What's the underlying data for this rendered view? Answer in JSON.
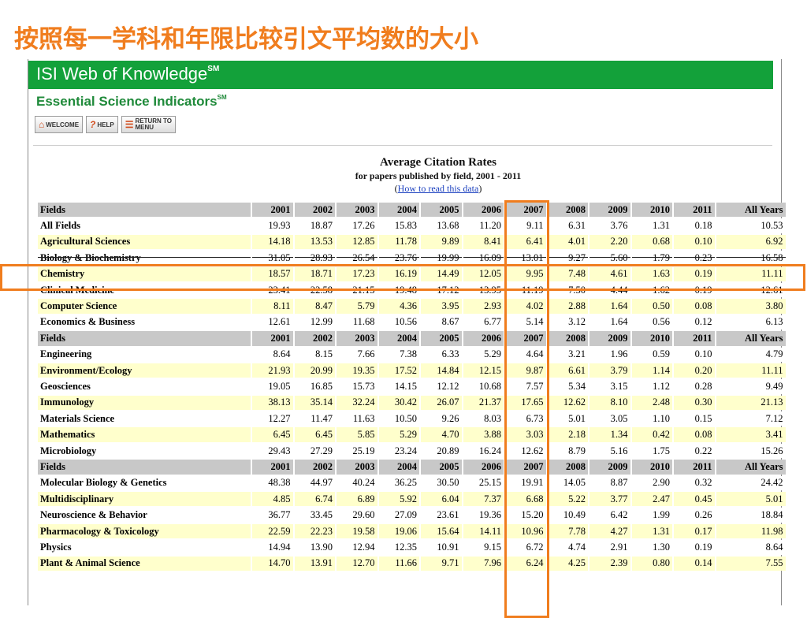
{
  "slide_title": "按照每一学科和年限比较引文平均数的大小",
  "app": {
    "brand": "ISI Web of Knowledge",
    "brand_mark": "SM",
    "product": "Essential Science Indicators",
    "product_mark": "SM"
  },
  "toolbar": {
    "welcome": "WELCOME",
    "help": "HELP",
    "return_line1": "RETURN TO",
    "return_line2": "MENU"
  },
  "heading": {
    "title": "Average Citation Rates",
    "subtitle": "for papers published by field, 2001 - 2011",
    "link_prefix": "(",
    "link": "How to read this data",
    "link_suffix": ")"
  },
  "table": {
    "header": [
      "Fields",
      "2001",
      "2002",
      "2003",
      "2004",
      "2005",
      "2006",
      "2007",
      "2008",
      "2009",
      "2010",
      "2011",
      "All Years"
    ],
    "rows": [
      {
        "type": "hdr",
        "cells": [
          "Fields",
          "2001",
          "2002",
          "2003",
          "2004",
          "2005",
          "2006",
          "2007",
          "2008",
          "2009",
          "2010",
          "2011",
          "All Years"
        ]
      },
      {
        "type": "data",
        "cells": [
          "All Fields",
          "19.93",
          "18.87",
          "17.26",
          "15.83",
          "13.68",
          "11.20",
          "9.11",
          "6.31",
          "3.76",
          "1.31",
          "0.18",
          "10.53"
        ]
      },
      {
        "type": "data",
        "cells": [
          "Agricultural Sciences",
          "14.18",
          "13.53",
          "12.85",
          "11.78",
          "9.89",
          "8.41",
          "6.41",
          "4.01",
          "2.20",
          "0.68",
          "0.10",
          "6.92"
        ]
      },
      {
        "type": "data",
        "cut": true,
        "cells": [
          "Biology & Biochemistry",
          "31.05",
          "28.93",
          "26.54",
          "23.76",
          "19.99",
          "16.09",
          "13.01",
          "9.27",
          "5.60",
          "1.79",
          "0.23",
          "16.58"
        ]
      },
      {
        "type": "data",
        "cells": [
          "Chemistry",
          "18.57",
          "18.71",
          "17.23",
          "16.19",
          "14.49",
          "12.05",
          "9.95",
          "7.48",
          "4.61",
          "1.63",
          "0.19",
          "11.11"
        ]
      },
      {
        "type": "data",
        "cells": [
          "Clinical Medicine",
          "23.41",
          "22.58",
          "21.15",
          "19.48",
          "17.12",
          "13.95",
          "11.19",
          "7.50",
          "4.44",
          "1.62",
          "0.19",
          "12.61"
        ]
      },
      {
        "type": "data",
        "cells": [
          "Computer Science",
          "8.11",
          "8.47",
          "5.79",
          "4.36",
          "3.95",
          "2.93",
          "4.02",
          "2.88",
          "1.64",
          "0.50",
          "0.08",
          "3.80"
        ]
      },
      {
        "type": "data",
        "cells": [
          "Economics & Business",
          "12.61",
          "12.99",
          "11.68",
          "10.56",
          "8.67",
          "6.77",
          "5.14",
          "3.12",
          "1.64",
          "0.56",
          "0.12",
          "6.13"
        ]
      },
      {
        "type": "hdr",
        "cells": [
          "Fields",
          "2001",
          "2002",
          "2003",
          "2004",
          "2005",
          "2006",
          "2007",
          "2008",
          "2009",
          "2010",
          "2011",
          "All Years"
        ]
      },
      {
        "type": "data",
        "cells": [
          "Engineering",
          "8.64",
          "8.15",
          "7.66",
          "7.38",
          "6.33",
          "5.29",
          "4.64",
          "3.21",
          "1.96",
          "0.59",
          "0.10",
          "4.79"
        ]
      },
      {
        "type": "data",
        "cells": [
          "Environment/Ecology",
          "21.93",
          "20.99",
          "19.35",
          "17.52",
          "14.84",
          "12.15",
          "9.87",
          "6.61",
          "3.79",
          "1.14",
          "0.20",
          "11.11"
        ]
      },
      {
        "type": "data",
        "cells": [
          "Geosciences",
          "19.05",
          "16.85",
          "15.73",
          "14.15",
          "12.12",
          "10.68",
          "7.57",
          "5.34",
          "3.15",
          "1.12",
          "0.28",
          "9.49"
        ]
      },
      {
        "type": "data",
        "cells": [
          "Immunology",
          "38.13",
          "35.14",
          "32.24",
          "30.42",
          "26.07",
          "21.37",
          "17.65",
          "12.62",
          "8.10",
          "2.48",
          "0.30",
          "21.13"
        ]
      },
      {
        "type": "data",
        "cells": [
          "Materials Science",
          "12.27",
          "11.47",
          "11.63",
          "10.50",
          "9.26",
          "8.03",
          "6.73",
          "5.01",
          "3.05",
          "1.10",
          "0.15",
          "7.12"
        ]
      },
      {
        "type": "data",
        "cells": [
          "Mathematics",
          "6.45",
          "6.45",
          "5.85",
          "5.29",
          "4.70",
          "3.88",
          "3.03",
          "2.18",
          "1.34",
          "0.42",
          "0.08",
          "3.41"
        ]
      },
      {
        "type": "data",
        "cells": [
          "Microbiology",
          "29.43",
          "27.29",
          "25.19",
          "23.24",
          "20.89",
          "16.24",
          "12.62",
          "8.79",
          "5.16",
          "1.75",
          "0.22",
          "15.26"
        ]
      },
      {
        "type": "hdr",
        "cells": [
          "Fields",
          "2001",
          "2002",
          "2003",
          "2004",
          "2005",
          "2006",
          "2007",
          "2008",
          "2009",
          "2010",
          "2011",
          "All Years"
        ]
      },
      {
        "type": "data",
        "cells": [
          "Molecular Biology & Genetics",
          "48.38",
          "44.97",
          "40.24",
          "36.25",
          "30.50",
          "25.15",
          "19.91",
          "14.05",
          "8.87",
          "2.90",
          "0.32",
          "24.42"
        ]
      },
      {
        "type": "data",
        "cells": [
          "Multidisciplinary",
          "4.85",
          "6.74",
          "6.89",
          "5.92",
          "6.04",
          "7.37",
          "6.68",
          "5.22",
          "3.77",
          "2.47",
          "0.45",
          "5.01"
        ]
      },
      {
        "type": "data",
        "cells": [
          "Neuroscience & Behavior",
          "36.77",
          "33.45",
          "29.60",
          "27.09",
          "23.61",
          "19.36",
          "15.20",
          "10.49",
          "6.42",
          "1.99",
          "0.26",
          "18.84"
        ]
      },
      {
        "type": "data",
        "cells": [
          "Pharmacology & Toxicology",
          "22.59",
          "22.23",
          "19.58",
          "19.06",
          "15.64",
          "14.11",
          "10.96",
          "7.78",
          "4.27",
          "1.31",
          "0.17",
          "11.98"
        ]
      },
      {
        "type": "data",
        "cells": [
          "Physics",
          "14.94",
          "13.90",
          "12.94",
          "12.35",
          "10.91",
          "9.15",
          "6.72",
          "4.74",
          "2.91",
          "1.30",
          "0.19",
          "8.64"
        ]
      },
      {
        "type": "data",
        "cells": [
          "Plant & Animal Science",
          "14.70",
          "13.91",
          "12.70",
          "11.66",
          "9.71",
          "7.96",
          "6.24",
          "4.25",
          "2.39",
          "0.80",
          "0.14",
          "7.55"
        ]
      }
    ]
  },
  "highlight": {
    "color": "#f07d1e",
    "column": "2007",
    "row": "Chemistry"
  }
}
